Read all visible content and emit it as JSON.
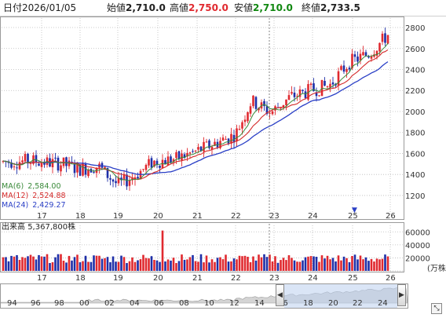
{
  "header": {
    "date_label": "日付",
    "date": "2026/01/05",
    "open_label": "始値",
    "open": "2,710.0",
    "high_label": "高値",
    "high": "2,750.0",
    "low_label": "安値",
    "low": "2,710.0",
    "close_label": "終値",
    "close": "2,733.5"
  },
  "colors": {
    "up": "#e0292f",
    "down": "#1e2fa8",
    "ma6": "#3a8a3a",
    "ma12": "#d42b2b",
    "ma24": "#2a3fc6",
    "high_value": "#e0292f",
    "low_value": "#118811",
    "volume_up": "#e0292f",
    "volume_down": "#1e2fa8",
    "scroll_fill": "#bcd0ee"
  },
  "ma_legend": {
    "ma6_label": "MA(6)",
    "ma6_value": "2,584.00",
    "ma12_label": "MA(12)",
    "ma12_value": "2,524.88",
    "ma24_label": "MA(24)",
    "ma24_value": "2,429.27"
  },
  "volume": {
    "title_label": "出来高",
    "title_value": "5,367,800株",
    "unit": "(万株)"
  },
  "scrollbar": {
    "left_arrow": "◀",
    "right_arrow": "▶"
  },
  "chart_data": [
    {
      "type": "candlestick",
      "x_ticks": [
        "17",
        "18",
        "19",
        "20",
        "21",
        "22",
        "23",
        "24",
        "25",
        "26"
      ],
      "y_ticks": [
        1200,
        1400,
        1600,
        1800,
        2000,
        2200,
        2400,
        2600,
        2800
      ],
      "ylim": [
        1020,
        2890
      ],
      "grid": true,
      "marker": "▼",
      "series": [
        {
          "name": "MA(6)"
        },
        {
          "name": "MA(12)"
        },
        {
          "name": "MA(24)"
        }
      ]
    },
    {
      "type": "bar",
      "y_ticks": [
        "60000",
        "40000",
        "20000",
        "0"
      ],
      "ylim": [
        0,
        70000
      ],
      "grid": true
    },
    {
      "type": "area",
      "x_ticks": [
        "94",
        "96",
        "98",
        "00",
        "02",
        "04",
        "06",
        "08",
        "10",
        "12",
        "14",
        "16",
        "18",
        "20",
        "22",
        "24"
      ]
    }
  ]
}
